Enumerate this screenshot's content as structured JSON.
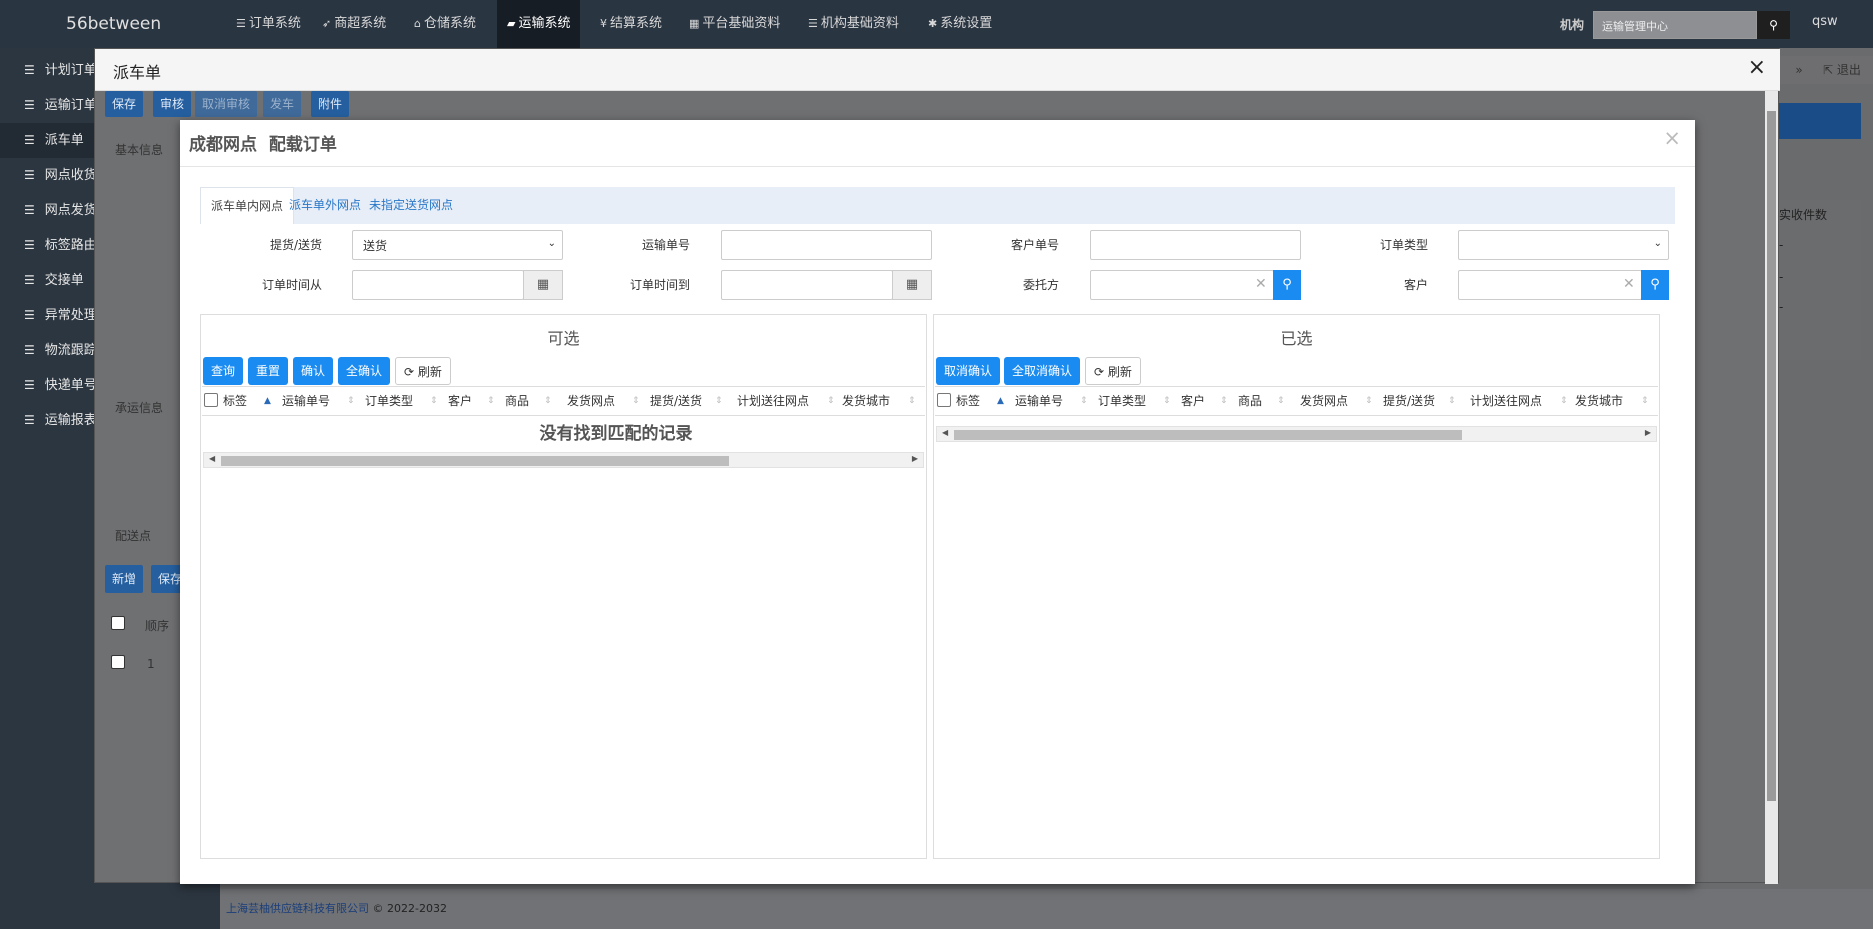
{
  "topnav": {
    "brand": "56between",
    "items": [
      {
        "label": "订单系统",
        "icon": "list-icon"
      },
      {
        "label": "商超系统",
        "icon": "rocket-icon"
      },
      {
        "label": "仓储系统",
        "icon": "home-icon"
      },
      {
        "label": "运输系统",
        "icon": "truck-icon",
        "active": true
      },
      {
        "label": "结算系统",
        "icon": "yen-icon"
      },
      {
        "label": "平台基础资料",
        "icon": "grid-icon"
      },
      {
        "label": "机构基础资料",
        "icon": "list-icon"
      },
      {
        "label": "系统设置",
        "icon": "gear-icon"
      }
    ],
    "org_label": "机构",
    "org_value": "运输管理中心",
    "user": "qsw"
  },
  "sidebar": {
    "items": [
      {
        "label": "计划订单"
      },
      {
        "label": "运输订单"
      },
      {
        "label": "派车单"
      },
      {
        "label": "网点收货"
      },
      {
        "label": "网点发货"
      },
      {
        "label": "标签路由"
      },
      {
        "label": "交接单"
      },
      {
        "label": "异常处理"
      },
      {
        "label": "物流跟踪"
      },
      {
        "label": "快递单号"
      },
      {
        "label": "运输报表"
      }
    ]
  },
  "background": {
    "exit_label": "退出",
    "actual_qty_label": "实收件数",
    "dash": "-"
  },
  "outer_modal": {
    "title": "派车单",
    "close": "×",
    "toolbar": {
      "save": "保存",
      "audit": "审核",
      "cancel_audit": "取消审核",
      "dispatch": "发车",
      "attachment": "附件"
    },
    "section_basic": "基本信息",
    "section_carrier": "承运信息",
    "tab_delivery_points": "配送点",
    "add": "新增",
    "save2": "保存",
    "col_order": "顺序",
    "row_order": "1"
  },
  "inner_modal": {
    "title": "成都网点  配载订单",
    "close": "×",
    "tabs": [
      "派车单内网点",
      "派车单外网点",
      "未指定送货网点"
    ],
    "filters": {
      "pickup_delivery_label": "提货/送货",
      "pickup_delivery_value": "送货",
      "transport_no_label": "运输单号",
      "customer_no_label": "客户单号",
      "order_type_label": "订单类型",
      "order_time_from_label": "订单时间从",
      "order_time_to_label": "订单时间到",
      "consignor_label": "委托方",
      "customer_label": "客户"
    },
    "available": {
      "title": "可选",
      "buttons": {
        "query": "查询",
        "reset": "重置",
        "confirm": "确认",
        "confirm_all": "全确认",
        "refresh": "刷新"
      },
      "columns": [
        "标签",
        "运输单号",
        "订单类型",
        "客户",
        "商品",
        "发货网点",
        "提货/送货",
        "计划送往网点",
        "发货城市"
      ],
      "empty_message": "没有找到匹配的记录"
    },
    "selected": {
      "title": "已选",
      "buttons": {
        "cancel_confirm": "取消确认",
        "cancel_all": "全取消确认",
        "refresh": "刷新"
      },
      "columns": [
        "标签",
        "运输单号",
        "订单类型",
        "客户",
        "商品",
        "发货网点",
        "提货/送货",
        "计划送往网点",
        "发货城市"
      ]
    }
  },
  "footer": {
    "company": "上海芸柚供应链科技有限公司",
    "copyright": "© 2022-2032"
  }
}
